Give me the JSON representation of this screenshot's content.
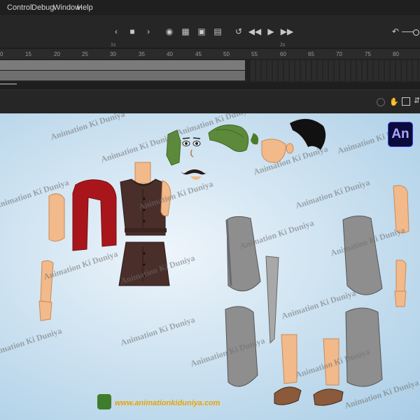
{
  "menu": {
    "items": [
      "Control",
      "Debug",
      "Window",
      "Help"
    ]
  },
  "timeline": {
    "frame_numbers": [
      "0",
      "15",
      "20",
      "25",
      "30",
      "35",
      "40",
      "45",
      "50",
      "55",
      "60",
      "65",
      "70",
      "75",
      "80"
    ],
    "seconds_markers": [
      "1s",
      "2s"
    ],
    "controls": [
      "prev-frame",
      "stop",
      "next-frame",
      "onion-skin",
      "edit-multiple",
      "insert-keyframe",
      "loop",
      "step-back",
      "play",
      "step-forward"
    ]
  },
  "stage": {
    "watermark": "Animation Ki Duniya",
    "app_badge": "An",
    "website": "www.animationkiduniya.com"
  },
  "colors": {
    "vest": "#4a2e2a",
    "scarf": "#a8161b",
    "turban": "#5c8a3a",
    "skin": "#f2b98a",
    "armor": "#8e8e8e",
    "stage_bg": "#cfe3f1"
  }
}
